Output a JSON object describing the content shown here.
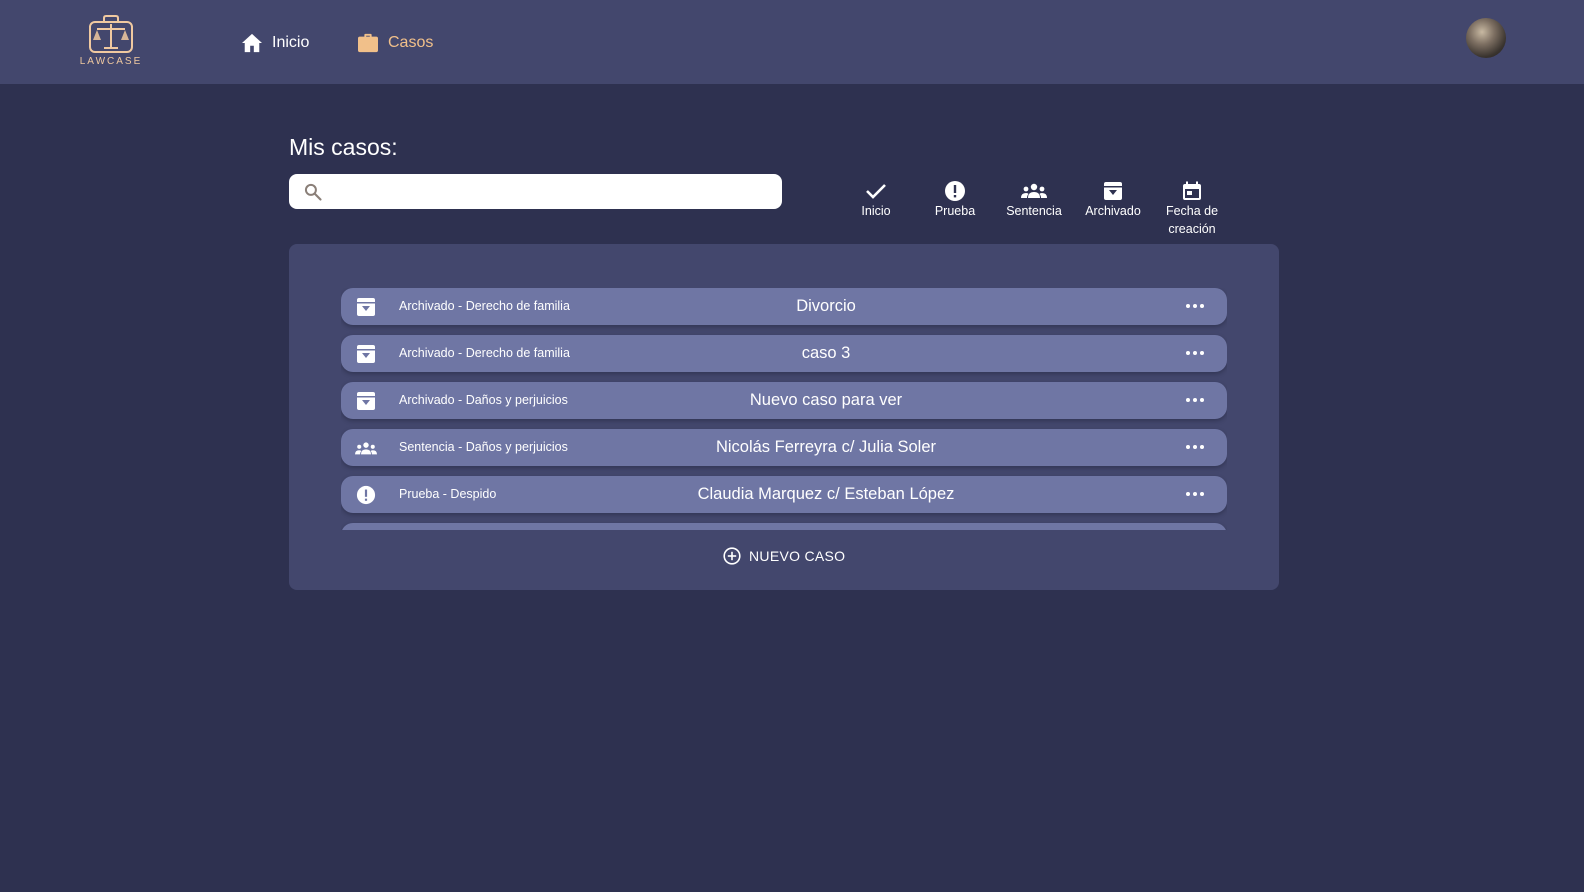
{
  "header": {
    "logo_text": "LAWCASE",
    "nav": [
      {
        "label": "Inicio",
        "icon": "home-icon"
      },
      {
        "label": "Casos",
        "icon": "briefcase-icon",
        "active": true
      }
    ],
    "avatar_icon": "user-avatar"
  },
  "main": {
    "title": "Mis casos:",
    "search": {
      "placeholder": "",
      "value": ""
    },
    "filters": [
      {
        "label": "Inicio",
        "icon": "check-icon"
      },
      {
        "label": "Prueba",
        "icon": "alert-circle-icon"
      },
      {
        "label": "Sentencia",
        "icon": "group-icon"
      },
      {
        "label": "Archivado",
        "icon": "archive-icon"
      },
      {
        "label": "Fecha de creación",
        "label_line1": "Fecha de",
        "label_line2": "creación",
        "icon": "calendar-icon"
      }
    ],
    "cases": [
      {
        "status": "Archivado - Derecho de familia",
        "title": "Divorcio",
        "icon": "archive-icon"
      },
      {
        "status": "Archivado - Derecho de familia",
        "title": "caso 3",
        "icon": "archive-icon"
      },
      {
        "status": "Archivado - Daños y perjuicios",
        "title": "Nuevo caso para ver",
        "icon": "archive-icon"
      },
      {
        "status": "Sentencia - Daños y perjuicios",
        "title": "Nicolás Ferreyra c/ Julia Soler",
        "icon": "group-icon"
      },
      {
        "status": "Prueba - Despido",
        "title": "Claudia Marquez c/ Esteban López",
        "icon": "alert-circle-icon"
      }
    ],
    "new_case_label": "NUEVO CASO"
  },
  "colors": {
    "background": "#2e3150",
    "header": "#43476d",
    "panel": "#43476d",
    "row": "#6f76a4",
    "accent": "#f1c08a"
  }
}
